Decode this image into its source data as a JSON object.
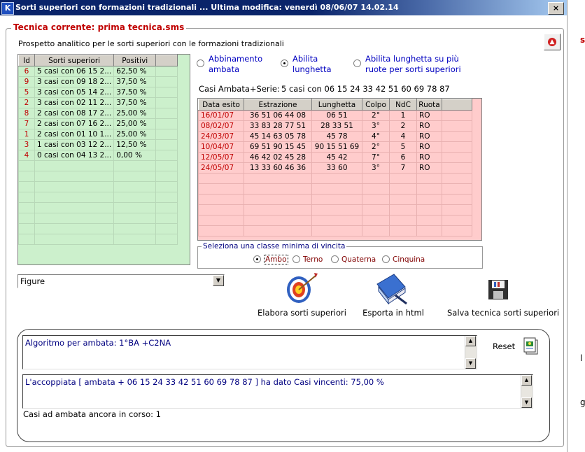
{
  "window": {
    "title": "Sorti superiori con formazioni tradizionali ... Ultima modifica: venerdì 08/06/07 14.02.14",
    "app_icon": "K",
    "close_glyph": "×",
    "side_letters": [
      "s",
      "l",
      "g"
    ]
  },
  "group": {
    "legend": "Tecnica corrente: prima tecnica.sms",
    "subtitle": "Prospetto analitico per le sorti superiori con le formazioni tradizionali"
  },
  "left_grid": {
    "columns": [
      "Id",
      "Sorti superiori",
      "Positivi"
    ],
    "rows": [
      {
        "id": "6",
        "sorti": "5 casi con 06 15 2...",
        "positivi": "62,50 %"
      },
      {
        "id": "9",
        "sorti": "3 casi con 09 18 2...",
        "positivi": "37,50 %"
      },
      {
        "id": "5",
        "sorti": "3 casi con 05 14 2...",
        "positivi": "37,50 %"
      },
      {
        "id": "2",
        "sorti": "3 casi con 02 11 2...",
        "positivi": "37,50 %"
      },
      {
        "id": "8",
        "sorti": "2 casi con 08 17 2...",
        "positivi": "25,00 %"
      },
      {
        "id": "7",
        "sorti": "2 casi con 07 16 2...",
        "positivi": "25,00 %"
      },
      {
        "id": "1",
        "sorti": "2 casi con 01 10 1...",
        "positivi": "25,00 %"
      },
      {
        "id": "3",
        "sorti": "1 casi con 03 12 2...",
        "positivi": "12,50 %"
      },
      {
        "id": "4",
        "sorti": "0 casi con 04 13 2...",
        "positivi": "0,00 %"
      }
    ]
  },
  "options": {
    "abbinamento": "Abbinamento ambata",
    "lunghetta": "Abilita lunghetta",
    "lunghetta_piu": "Abilita lunghetta su più ruote per sorti superiori",
    "selected": "lunghetta"
  },
  "casi": {
    "label": "Casi Ambata+Serie:",
    "value": "5 casi con 06 15 24 33 42 51 60 69 78 87"
  },
  "right_grid": {
    "columns": [
      "Data esito",
      "Estrazione",
      "Lunghetta",
      "Colpo",
      "NdC",
      "Ruota"
    ],
    "rows": [
      {
        "data": "16/01/07",
        "estrazione": "36 51 06 44 08",
        "lunghetta": "06 51",
        "colpo": "2°",
        "ndc": "1",
        "ruota": "RO"
      },
      {
        "data": "08/02/07",
        "estrazione": "33 83 28 77 51",
        "lunghetta": "28 33 51",
        "colpo": "3°",
        "ndc": "2",
        "ruota": "RO"
      },
      {
        "data": "24/03/07",
        "estrazione": "45 14 63 05 78",
        "lunghetta": "45 78",
        "colpo": "4°",
        "ndc": "4",
        "ruota": "RO"
      },
      {
        "data": "10/04/07",
        "estrazione": "69 51 90 15 45",
        "lunghetta": "90 15 51 69",
        "colpo": "2°",
        "ndc": "5",
        "ruota": "RO"
      },
      {
        "data": "12/05/07",
        "estrazione": "46 42 02 45 28",
        "lunghetta": "45 42",
        "colpo": "7°",
        "ndc": "6",
        "ruota": "RO"
      },
      {
        "data": "24/05/07",
        "estrazione": "13 33 60 46 36",
        "lunghetta": "33 60",
        "colpo": "3°",
        "ndc": "7",
        "ruota": "RO"
      }
    ]
  },
  "class_group": {
    "legend": "Seleziona una classe minima di vincita",
    "options": [
      "Ambo",
      "Terno",
      "Quaterna",
      "Cinquina"
    ],
    "selected": "Ambo"
  },
  "figure_select": {
    "value": "Figure"
  },
  "actions": {
    "elabora": "Elabora sorti superiori",
    "esporta": "Esporta in html",
    "salva": "Salva tecnica sorti superiori"
  },
  "bottom": {
    "algoritmo": "Algoritmo per ambata: 1°BA +C2NA",
    "accoppiata": "L'accoppiata [ ambata + 06 15 24 33 42 51 60 69 78 87 ] ha dato  Casi vincenti: 75,00 %",
    "reset": "Reset",
    "in_corso": "Casi ad ambata ancora in corso:  1"
  },
  "colors": {
    "titlebar": "#0a246a",
    "legend_red": "#c00000",
    "left_grid_bg": "#ccf0cc",
    "right_grid_bg": "#ffcccc",
    "option_blue": "#0000c0"
  }
}
